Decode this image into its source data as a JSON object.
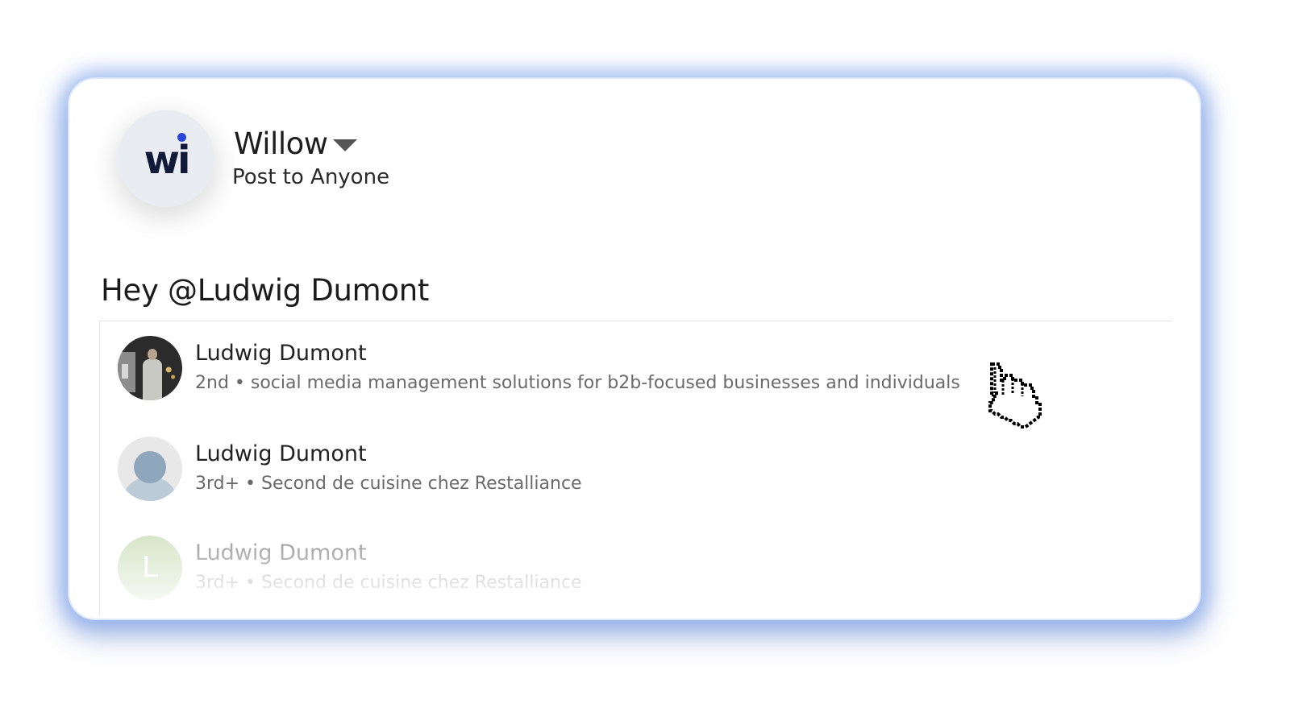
{
  "header": {
    "logo_text": "wi",
    "account_name": "Willow",
    "visibility": "Post to Anyone"
  },
  "post": {
    "text": "Hey @Ludwig Dumont"
  },
  "mentions": [
    {
      "name": "Ludwig Dumont",
      "description": "2nd • social media management solutions for b2b-focused businesses and individuals",
      "avatar": "photo"
    },
    {
      "name": "Ludwig Dumont",
      "description": "3rd+ • Second de cuisine chez Restalliance",
      "avatar": "default-silhouette"
    },
    {
      "name": "Ludwig Dumont",
      "description": "3rd+ • Second de cuisine chez Restalliance",
      "avatar_letter": "L",
      "avatar": "letter"
    }
  ],
  "icons": {
    "account_dropdown": "caret-down-icon",
    "cursor": "hand-pointer-icon"
  },
  "colors": {
    "brand_dot": "#2b46d8",
    "brand_text": "#121a3a",
    "card_glow": "#7aa0ec"
  }
}
